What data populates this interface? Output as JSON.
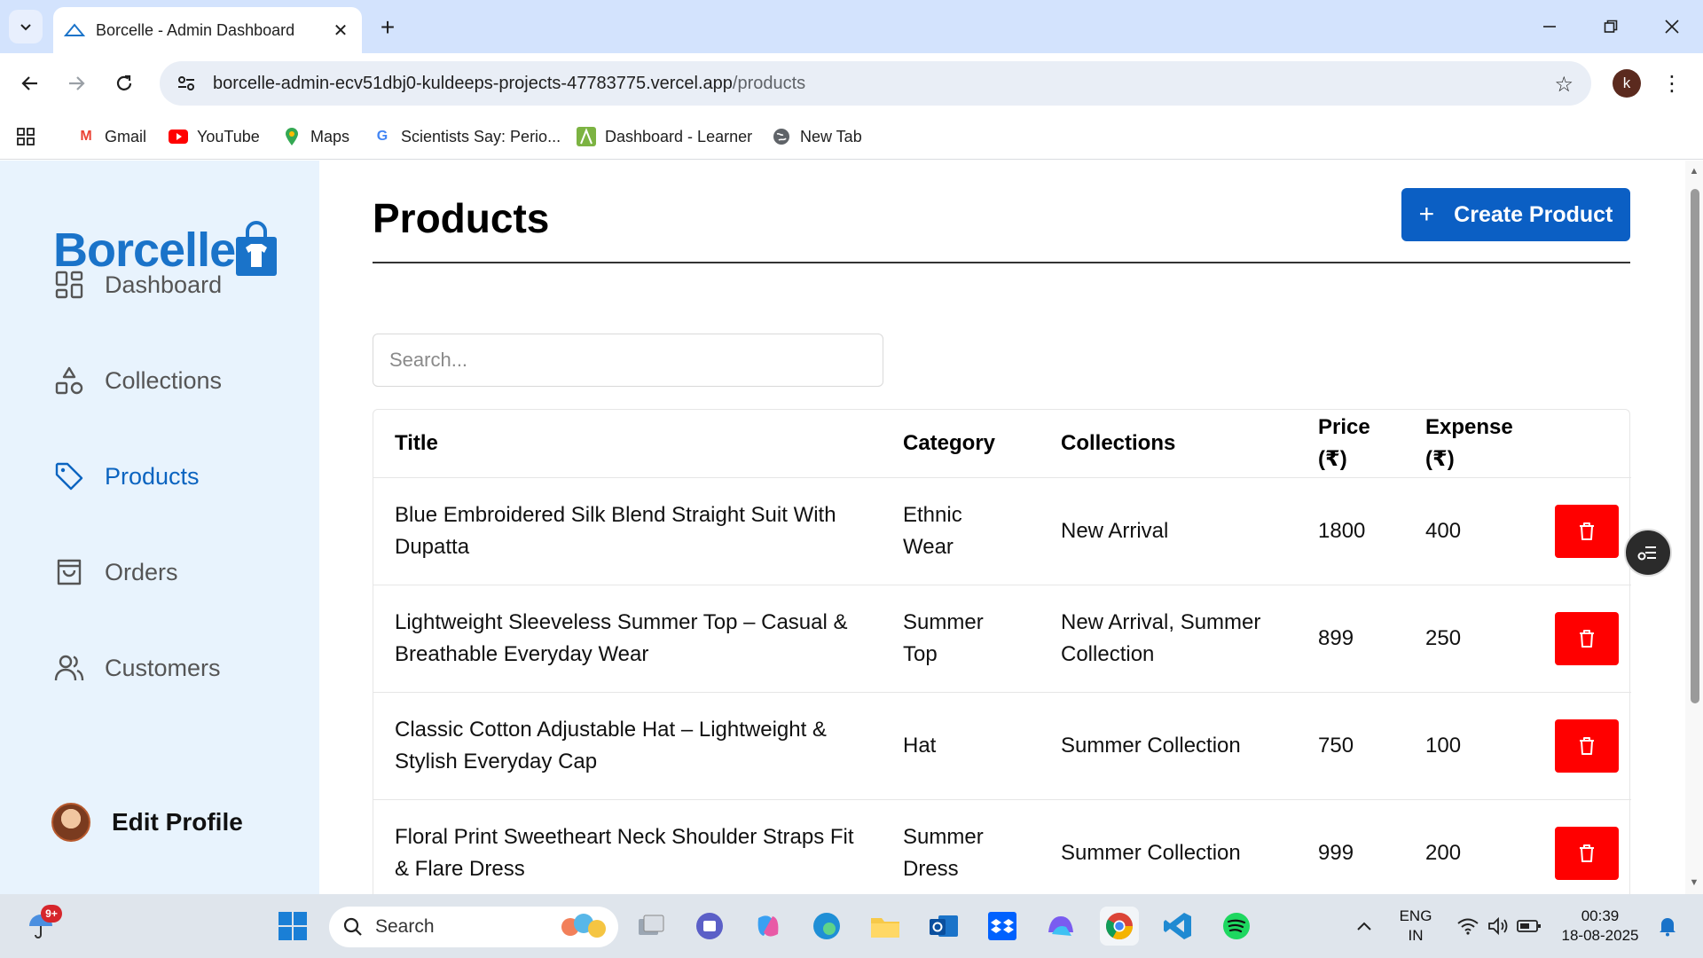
{
  "browser": {
    "tab_title": "Borcelle - Admin Dashboard",
    "url_host": "borcelle-admin-ecv51dbj0-kuldeeps-projects-47783775.vercel.app",
    "url_path": "/products",
    "profile_initial": "k",
    "bookmarks": [
      {
        "label": "Gmail",
        "icon": "gmail-icon"
      },
      {
        "label": "YouTube",
        "icon": "youtube-icon"
      },
      {
        "label": "Maps",
        "icon": "maps-icon"
      },
      {
        "label": "Scientists Say: Perio...",
        "icon": "google-icon"
      },
      {
        "label": "Dashboard - Learner",
        "icon": "learner-icon"
      },
      {
        "label": "New Tab",
        "icon": "globe-icon"
      }
    ]
  },
  "sidebar": {
    "logo": "Borcelle",
    "items": [
      {
        "label": "Dashboard",
        "icon": "dashboard-icon",
        "active": false
      },
      {
        "label": "Collections",
        "icon": "shapes-icon",
        "active": false
      },
      {
        "label": "Products",
        "icon": "tag-icon",
        "active": true
      },
      {
        "label": "Orders",
        "icon": "shopping-bag-icon",
        "active": false
      },
      {
        "label": "Customers",
        "icon": "users-icon",
        "active": false
      }
    ],
    "edit_profile": "Edit Profile"
  },
  "main": {
    "title": "Products",
    "create_button": "Create Product",
    "search_placeholder": "Search...",
    "table": {
      "headers": [
        "Title",
        "Category",
        "Collections",
        "Price (₹)",
        "Expense (₹)"
      ],
      "rows": [
        {
          "title": "Blue Embroidered Silk Blend Straight Suit With Dupatta",
          "category": "Ethnic Wear",
          "collections": "New Arrival",
          "price": "1800",
          "expense": "400"
        },
        {
          "title": "Lightweight Sleeveless Summer Top – Casual & Breathable Everyday Wear",
          "category": "Summer Top",
          "collections": "New Arrival, Summer Collection",
          "price": "899",
          "expense": "250"
        },
        {
          "title": "Classic Cotton Adjustable Hat – Lightweight & Stylish Everyday Cap",
          "category": "Hat",
          "collections": "Summer Collection",
          "price": "750",
          "expense": "100"
        },
        {
          "title": "Floral Print Sweetheart Neck Shoulder Straps Fit & Flare Dress",
          "category": "Summer Dress",
          "collections": "Summer Collection",
          "price": "999",
          "expense": "200"
        }
      ]
    }
  },
  "taskbar": {
    "search_label": "Search",
    "notification_badge": "9+",
    "lang_line1": "ENG",
    "lang_line2": "IN",
    "time": "00:39",
    "date": "18-08-2025"
  },
  "colors": {
    "accent": "#0b5fc4",
    "sidebar_bg": "#e8f3fd",
    "delete": "#ff0000",
    "active_nav": "#0b64c0"
  }
}
